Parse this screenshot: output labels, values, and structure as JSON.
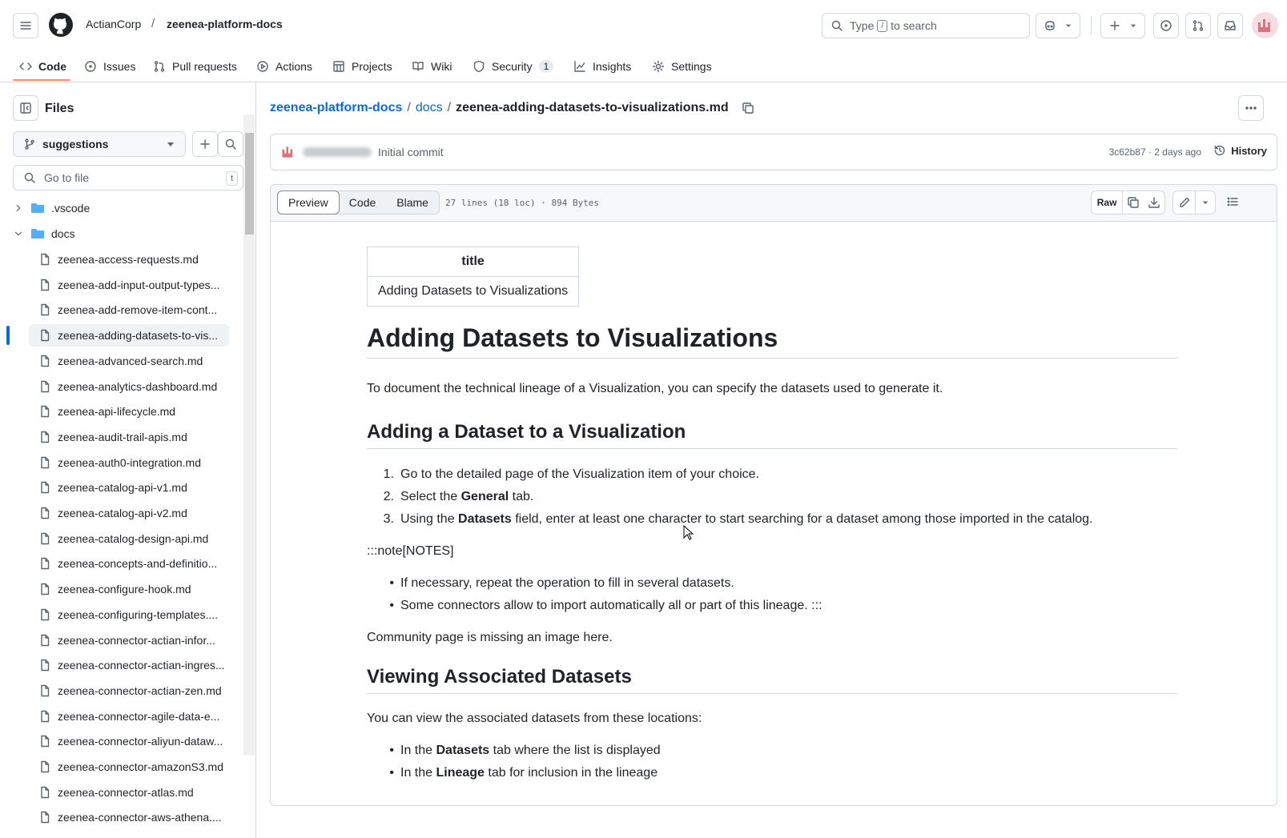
{
  "header": {
    "owner": "ActianCorp",
    "separator": "/",
    "repo": "zeenea-platform-docs",
    "search_prefix": "Type",
    "search_key": "/",
    "search_suffix": "to search"
  },
  "nav": {
    "items": [
      {
        "label": "Code",
        "icon": "code-icon"
      },
      {
        "label": "Issues",
        "icon": "issue-icon"
      },
      {
        "label": "Pull requests",
        "icon": "pull-request-icon"
      },
      {
        "label": "Actions",
        "icon": "play-icon"
      },
      {
        "label": "Projects",
        "icon": "table-icon"
      },
      {
        "label": "Wiki",
        "icon": "book-icon"
      },
      {
        "label": "Security",
        "icon": "shield-icon",
        "count": "1"
      },
      {
        "label": "Insights",
        "icon": "graph-icon"
      },
      {
        "label": "Settings",
        "icon": "gear-icon"
      }
    ]
  },
  "sidebar": {
    "title": "Files",
    "branch": "suggestions",
    "goto_placeholder": "Go to file",
    "goto_key": "t",
    "folders": [
      ".vscode",
      "docs"
    ],
    "files": [
      "zeenea-access-requests.md",
      "zeenea-add-input-output-types...",
      "zeenea-add-remove-item-cont...",
      "zeenea-adding-datasets-to-vis...",
      "zeenea-advanced-search.md",
      "zeenea-analytics-dashboard.md",
      "zeenea-api-lifecycle.md",
      "zeenea-audit-trail-apis.md",
      "zeenea-auth0-integration.md",
      "zeenea-catalog-api-v1.md",
      "zeenea-catalog-api-v2.md",
      "zeenea-catalog-design-api.md",
      "zeenea-concepts-and-definitio...",
      "zeenea-configure-hook.md",
      "zeenea-configuring-templates....",
      "zeenea-connector-actian-infor...",
      "zeenea-connector-actian-ingres...",
      "zeenea-connector-actian-zen.md",
      "zeenea-connector-agile-data-e...",
      "zeenea-connector-aliyun-dataw...",
      "zeenea-connector-amazonS3.md",
      "zeenea-connector-atlas.md",
      "zeenea-connector-aws-athena...."
    ],
    "selected_index": 3
  },
  "breadcrumb": {
    "repo": "zeenea-platform-docs",
    "folder": "docs",
    "sep": "/",
    "file": "zeenea-adding-datasets-to-visualizations.md"
  },
  "commit": {
    "message": "Initial commit",
    "meta": "3c62b87 · 2 days ago",
    "history_label": "History"
  },
  "file": {
    "tabs": [
      "Preview",
      "Code",
      "Blame"
    ],
    "active_tab": "Preview",
    "info": "27 lines (18 loc) · 894 Bytes",
    "raw_label": "Raw"
  },
  "doc": {
    "fm_header": "title",
    "fm_value": "Adding Datasets to Visualizations",
    "h1": "Adding Datasets to Visualizations",
    "intro": "To document the technical lineage of a Visualization, you can specify the datasets used to generate it.",
    "h2_add": "Adding a Dataset to a Visualization",
    "steps": [
      {
        "n": "1.",
        "pre": "Go to the detailed page of the Visualization item of your choice.",
        "b": "",
        "post": ""
      },
      {
        "n": "2.",
        "pre": "Select the ",
        "b": "General",
        "post": " tab."
      },
      {
        "n": "3.",
        "pre": "Using the ",
        "b": "Datasets",
        "post": " field, enter at least one character to start searching for a dataset among those imported in the catalog."
      }
    ],
    "note": ":::note[NOTES]",
    "bullets": [
      "If necessary, repeat the operation to fill in several datasets.",
      "Some connectors allow to import automatically all or part of this lineage. :::"
    ],
    "missing": "Community page is missing an image here.",
    "h2_view": "Viewing Associated Datasets",
    "view_intro": "You can view the associated datasets from these locations:",
    "view_items": [
      {
        "pre": "In the ",
        "b": "Datasets",
        "post": " tab where the list is displayed"
      },
      {
        "pre": "In the ",
        "b": "Lineage",
        "post": " tab for inclusion in the lineage"
      }
    ]
  }
}
